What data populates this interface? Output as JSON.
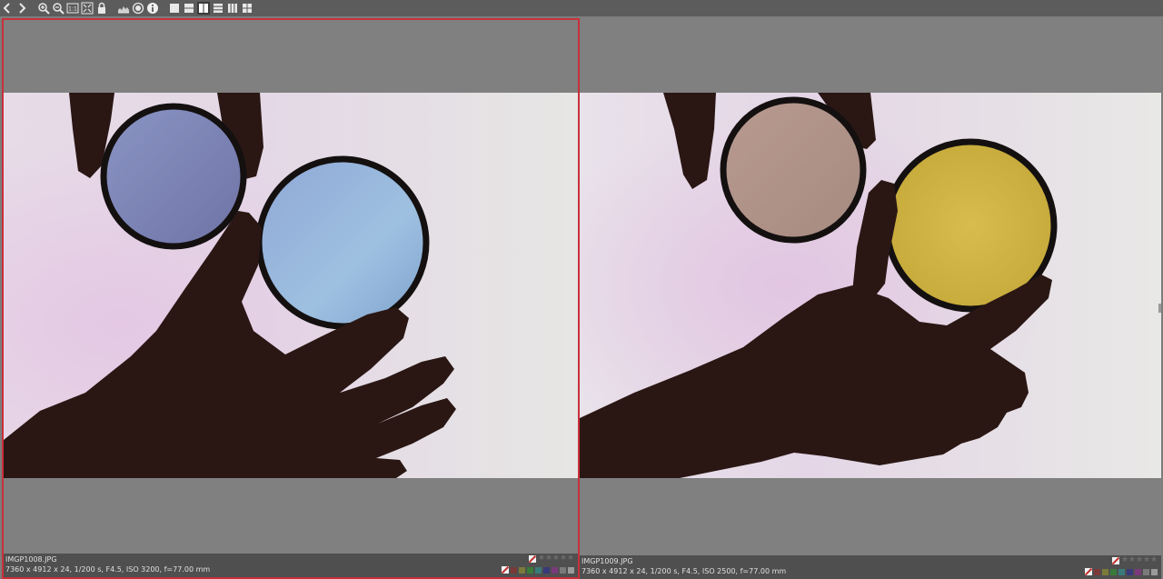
{
  "toolbar": {
    "buttons": [
      {
        "name": "back-icon"
      },
      {
        "name": "forward-icon"
      },
      {
        "name": "zoom-in-icon"
      },
      {
        "name": "zoom-out-icon"
      },
      {
        "name": "zoom-100-icon"
      },
      {
        "name": "fit-screen-icon"
      },
      {
        "name": "lock-icon"
      },
      {
        "name": "histogram-icon"
      },
      {
        "name": "focus-icon"
      },
      {
        "name": "info-icon"
      },
      {
        "name": "layout-single-icon"
      },
      {
        "name": "layout-rows-icon"
      },
      {
        "name": "layout-columns-icon"
      },
      {
        "name": "layout-rows3-icon"
      },
      {
        "name": "layout-columns3-icon"
      },
      {
        "name": "layout-grid-icon"
      }
    ],
    "zoom_100_label": "1:1"
  },
  "left_image": {
    "filename": "IMGP1008.JPG",
    "exif": "7360 x 4912 x 24, 1/200 s, F4.5, ISO 3200, f=77.00 mm",
    "selected": true
  },
  "right_image": {
    "filename": "IMGP1009.JPG",
    "exif": "7360 x 4912 x 24, 1/200 s, F4.5, ISO 2500, f=77.00 mm",
    "selected": false
  },
  "label_colors": [
    "#7a3a3a",
    "#7a7a3a",
    "#3a7a3a",
    "#3a7a7a",
    "#3a3a7a",
    "#7a3a7a",
    "#7a7a7a",
    "#9a9a9a"
  ],
  "colors": {
    "selection_border": "#c8303a",
    "background": "#808080",
    "toolbar": "#5c5c5c"
  }
}
